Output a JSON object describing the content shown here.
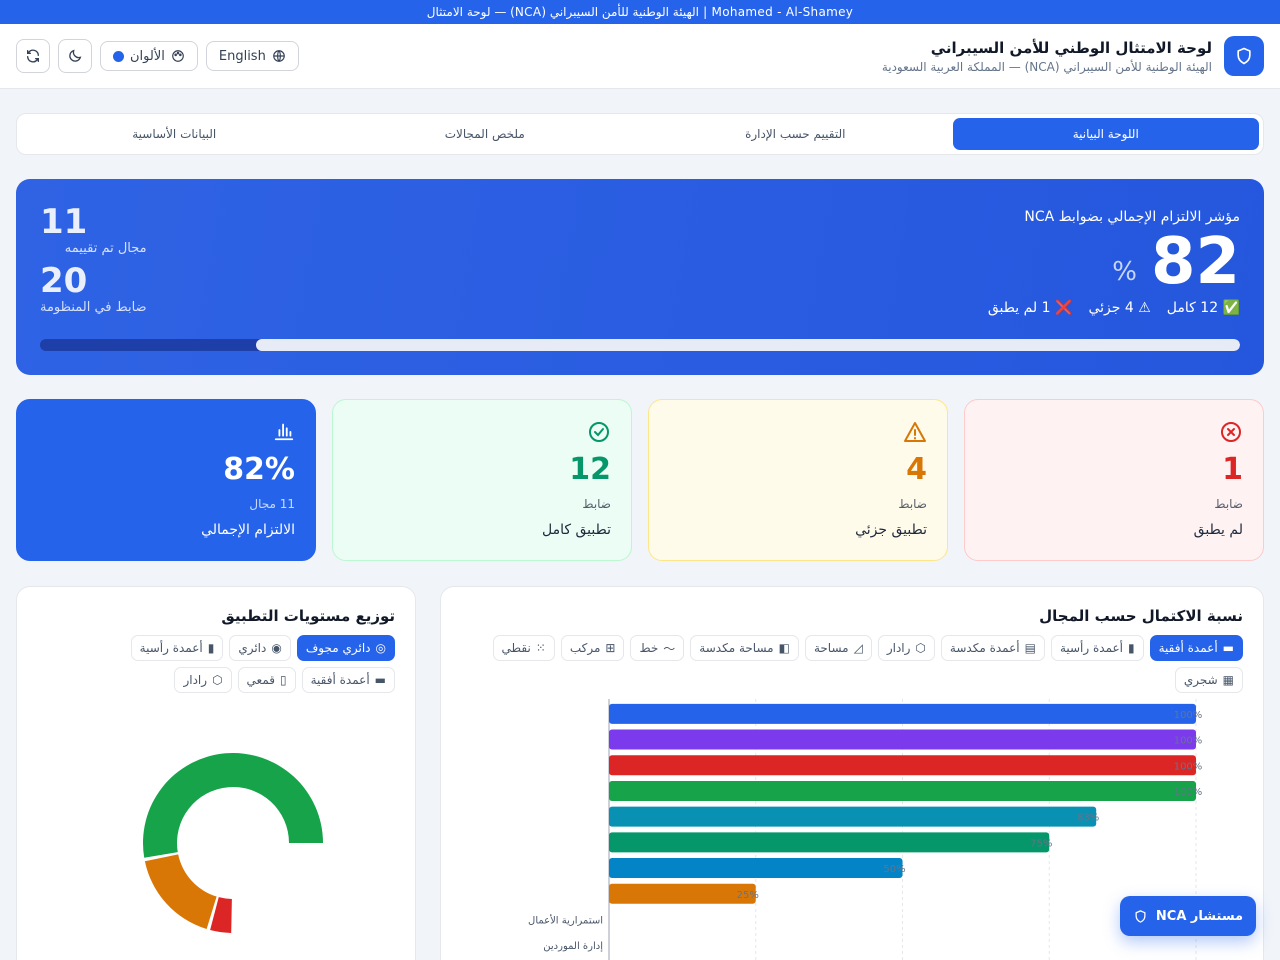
{
  "topbar": {
    "text": "Mohamed - Al-Shamey | الهيئة الوطنية للأمن السيبراني (NCA) — لوحة الامتثال"
  },
  "header": {
    "title": "لوحة الامتثال الوطني للأمن السيبراني",
    "subtitle": "الهيئة الوطنية للأمن السيبراني (NCA) — المملكة العربية السعودية",
    "language_label": "English",
    "colors_label": "الألوان",
    "accent_color": "#2563eb"
  },
  "tabs": [
    {
      "label": "اللوحة البيانية",
      "active": true
    },
    {
      "label": "التقييم حسب الإدارة",
      "active": false
    },
    {
      "label": "ملخص المجالات",
      "active": false
    },
    {
      "label": "البيانات الأساسية",
      "active": false
    }
  ],
  "hero": {
    "label": "مؤشر الالتزام الإجمالي بضوابط NCA",
    "score": "82",
    "percent_sign": "%",
    "breakdown": [
      "✅ 12 كامل",
      "⚠ 4 جزئي",
      "❌ 1 لم يطبق"
    ],
    "domains_count": "11",
    "domains_label": "مجال تم تقييمه",
    "controls_count": "20",
    "controls_label": "ضابط في المنظومة",
    "progress_fraction": 0.82
  },
  "cards": [
    {
      "num": "82%",
      "sub": "11 مجال",
      "label": "الالتزام الإجمالي",
      "icon": "bar-chart-icon",
      "tone": "blue"
    },
    {
      "num": "12",
      "sub": "ضابط",
      "label": "تطبيق كامل",
      "icon": "check-circle-icon",
      "tone": "green"
    },
    {
      "num": "4",
      "sub": "ضابط",
      "label": "تطبيق جزئي",
      "icon": "warning-icon",
      "tone": "amber"
    },
    {
      "num": "1",
      "sub": "ضابط",
      "label": "لم يطبق",
      "icon": "x-circle-icon",
      "tone": "red"
    }
  ],
  "domain_panel": {
    "title": "نسبة الاكتمال حسب المجال",
    "chips": [
      {
        "glyph": "▬",
        "label": "أعمدة أفقية",
        "active": true
      },
      {
        "glyph": "▮",
        "label": "أعمدة رأسية",
        "active": false
      },
      {
        "glyph": "▤",
        "label": "أعمدة مكدسة",
        "active": false
      },
      {
        "glyph": "⬡",
        "label": "رادار",
        "active": false
      },
      {
        "glyph": "◿",
        "label": "مساحة",
        "active": false
      },
      {
        "glyph": "◧",
        "label": "مساحة مكدسة",
        "active": false
      },
      {
        "glyph": "〜",
        "label": "خط",
        "active": false
      },
      {
        "glyph": "⊞",
        "label": "مركب",
        "active": false
      },
      {
        "glyph": "⁙",
        "label": "نقطي",
        "active": false
      },
      {
        "glyph": "▦",
        "label": "شجري",
        "active": false
      }
    ]
  },
  "dist_panel": {
    "title": "توزيع مستويات التطبيق",
    "chips": [
      {
        "glyph": "◎",
        "label": "دائري مجوف",
        "active": true
      },
      {
        "glyph": "◉",
        "label": "دائري",
        "active": false
      },
      {
        "glyph": "▮",
        "label": "أعمدة رأسية",
        "active": false
      },
      {
        "glyph": "▬",
        "label": "أعمدة أفقية",
        "active": false
      },
      {
        "glyph": "▯",
        "label": "قمعي",
        "active": false
      },
      {
        "glyph": "⬡",
        "label": "رادار",
        "active": false
      }
    ]
  },
  "fab_label": "مستشار NCA",
  "chart_data": [
    {
      "type": "bar",
      "orientation": "horizontal",
      "categories": [
        "",
        "",
        "",
        "",
        "",
        "",
        "",
        "",
        "استمرارية الأعمال",
        "إدارة الموردين"
      ],
      "values": [
        100,
        100,
        100,
        100,
        83,
        75,
        50,
        25,
        null,
        null
      ],
      "value_labels": [
        "100%",
        "100%",
        "100%",
        "100%",
        "83%",
        "75%",
        "50%",
        "25%",
        "",
        ""
      ],
      "colors": [
        "#2563eb",
        "#7c3aed",
        "#dc2626",
        "#16a34a",
        "#0891b2",
        "#059669",
        "#0284c7",
        "#d97706"
      ],
      "xlim": [
        0,
        100
      ],
      "grid": true
    },
    {
      "type": "pie",
      "variant": "donut",
      "categories": [
        "تطبيق كامل",
        "تطبيق جزئي",
        "لم يطبق"
      ],
      "values": [
        12,
        4,
        1
      ],
      "colors": [
        "#16a34a",
        "#d97706",
        "#dc2626"
      ]
    }
  ]
}
